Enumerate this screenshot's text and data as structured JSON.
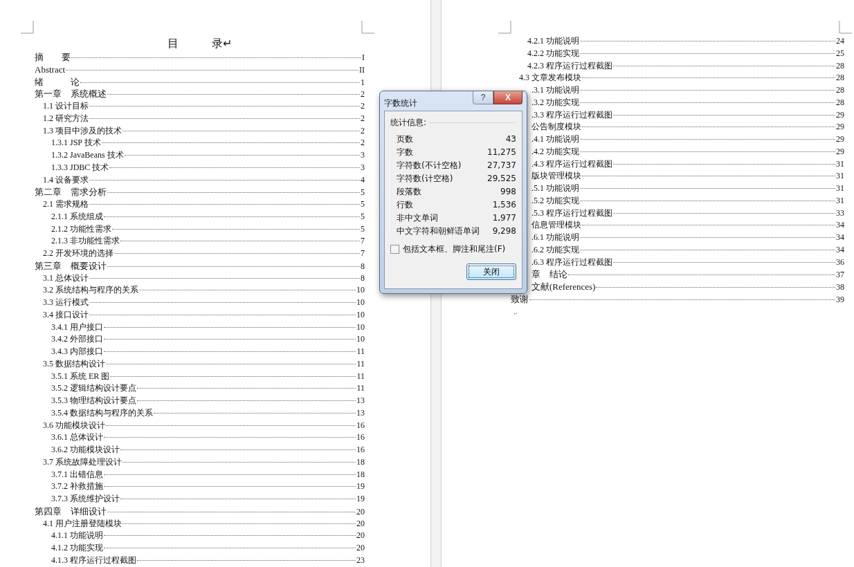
{
  "left_page": {
    "title": "目　　　录↵",
    "entries": [
      {
        "title": "摘　　要",
        "page": "I"
      },
      {
        "title": "Abstract",
        "page": "II"
      },
      {
        "title": "绪　　　论",
        "page": "1"
      },
      {
        "title": "第一章　系统概述",
        "page": "2",
        "children": [
          {
            "title": "1.1 设计目标",
            "page": "2"
          },
          {
            "title": "1.2  研究方法",
            "page": "2"
          },
          {
            "title": "1.3 项目中涉及的技术",
            "page": "2",
            "children": [
              {
                "title": "1.3.1  JSP 技术",
                "page": "2"
              },
              {
                "title": "1.3.2  JavaBeans 技术",
                "page": "3"
              },
              {
                "title": "1.3.3  JDBC 技术",
                "page": "3"
              }
            ]
          },
          {
            "title": "1.4 设备要求",
            "page": "4"
          }
        ]
      },
      {
        "title": "第二章　需求分析",
        "page": "5",
        "children": [
          {
            "title": "2.1 需求规格",
            "page": "5",
            "children": [
              {
                "title": "2.1.1 系统组成",
                "page": "5"
              },
              {
                "title": "2.1.2 功能性需求",
                "page": "5"
              },
              {
                "title": "2.1.3 非功能性需求",
                "page": "7"
              }
            ]
          },
          {
            "title": "2.2 开发环境的选择",
            "page": "7"
          }
        ]
      },
      {
        "title": "第三章　概要设计",
        "page": "8",
        "children": [
          {
            "title": "3.1 总体设计",
            "page": "8"
          },
          {
            "title": "3.2 系统结构与程序的关系",
            "page": "10"
          },
          {
            "title": "3.3 运行模式",
            "page": "10"
          },
          {
            "title": "3.4 接口设计",
            "page": "10",
            "children": [
              {
                "title": "3.4.1 用户接口",
                "page": "10"
              },
              {
                "title": "3.4.2 外部接口",
                "page": "10"
              },
              {
                "title": "3.4.3 内部接口",
                "page": "11"
              }
            ]
          },
          {
            "title": "3.5 数据结构设计",
            "page": "11",
            "children": [
              {
                "title": "3.5.1 系统 ER 图",
                "page": "11"
              },
              {
                "title": "3.5.2 逻辑结构设计要点",
                "page": "11"
              },
              {
                "title": "3.5.3 物理结构设计要点",
                "page": "13"
              },
              {
                "title": "3.5.4 数据结构与程序的关系",
                "page": "13"
              }
            ]
          },
          {
            "title": "3.6 功能模块设计",
            "page": "16",
            "children": [
              {
                "title": "3.6.1 总体设计",
                "page": "16"
              },
              {
                "title": "3.6.2 功能模块设计",
                "page": "16"
              }
            ]
          },
          {
            "title": "3.7 系统故障处理设计",
            "page": "18",
            "children": [
              {
                "title": "3.7.1 出错信息",
                "page": "18"
              },
              {
                "title": "3.7.2 补救措施",
                "page": "19"
              },
              {
                "title": "3.7.3 系统维护设计",
                "page": "19"
              }
            ]
          }
        ]
      },
      {
        "title": "第四章　详细设计",
        "page": "20",
        "children": [
          {
            "title": "4.1 用户注册登陆模块",
            "page": "20",
            "children": [
              {
                "title": "4.1.1 功能说明",
                "page": "20"
              },
              {
                "title": "4.1.2 功能实现",
                "page": "20"
              },
              {
                "title": "4.1.3 程序运行过程截图",
                "page": "23"
              }
            ]
          }
        ]
      }
    ]
  },
  "right_page": {
    "entries": [
      {
        "children": [
          {
            "children": [
              {
                "title": "4.2.1 功能说明",
                "page": "24"
              },
              {
                "title": "4.2.2 功能实现",
                "page": "25"
              },
              {
                "title": "4.2.3 程序运行过程截图",
                "page": "28"
              }
            ]
          },
          {
            "title": "4.3 文章发布模块",
            "page": "28",
            "covered": false,
            "children": [
              {
                "title": ".3.1 功能说明",
                "page": "28",
                "covered": true
              },
              {
                "title": ".3.2 功能实现",
                "page": "28",
                "covered": true
              },
              {
                "title": ".3.3 程序运行过程截图",
                "page": "29",
                "covered": true
              }
            ]
          },
          {
            "title": "公告制度模块",
            "page": "29",
            "covered": true,
            "children": [
              {
                "title": ".4.1 功能说明",
                "page": "29",
                "covered": true
              },
              {
                "title": ".4.2 功能实现",
                "page": "29",
                "covered": true
              },
              {
                "title": ".4.3 程序运行过程截图",
                "page": "31",
                "covered": true
              }
            ]
          },
          {
            "title": "版块管理模块",
            "page": "31",
            "covered": true,
            "children": [
              {
                "title": ".5.1 功能说明",
                "page": "31",
                "covered": true
              },
              {
                "title": ".5.2 功能实现",
                "page": "31",
                "covered": true
              },
              {
                "title": ".5.3 程序运行过程截图",
                "page": "33",
                "covered": true
              }
            ]
          },
          {
            "title": "信息管理模块",
            "page": "34",
            "covered": true,
            "children": [
              {
                "title": ".6.1 功能说明",
                "page": "34",
                "covered": true
              },
              {
                "title": ".6.2 功能实现",
                "page": "34",
                "covered": true
              },
              {
                "title": ".6.3 程序运行过程截图",
                "page": "36",
                "covered": true
              }
            ]
          }
        ]
      },
      {
        "title": "章　结论",
        "page": "37",
        "covered": true
      },
      {
        "title": "文献(References)",
        "page": "38",
        "covered": true
      },
      {
        "title": "致谢",
        "page": "39",
        "covered": false
      }
    ],
    "end_mark": "↵"
  },
  "dialog": {
    "title": "字数统计",
    "help": "?",
    "close": "X",
    "group_label": "统计信息:",
    "stats": [
      {
        "label": "页数",
        "value": "43"
      },
      {
        "label": "字数",
        "value": "11,275"
      },
      {
        "label": "字符数(不计空格)",
        "value": "27,737"
      },
      {
        "label": "字符数(计空格)",
        "value": "29,525"
      },
      {
        "label": "段落数",
        "value": "998"
      },
      {
        "label": "行数",
        "value": "1,536"
      },
      {
        "label": "非中文单词",
        "value": "1,977"
      },
      {
        "label": "中文字符和朝鲜语单词",
        "value": "9,298"
      }
    ],
    "checkbox": {
      "label": "包括文本框、脚注和尾注(F)",
      "checked": false
    },
    "button": "关闭"
  }
}
